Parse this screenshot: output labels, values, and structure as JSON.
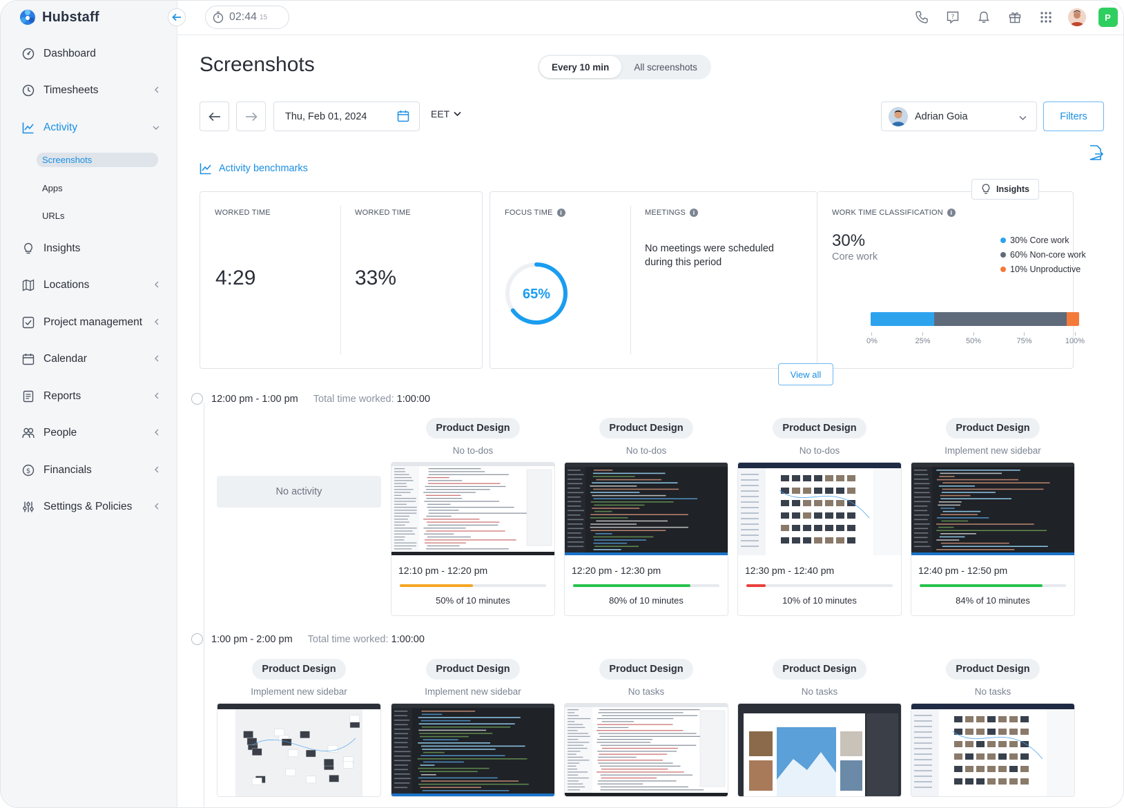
{
  "brand": {
    "name": "Hubstaff"
  },
  "timer": {
    "time": "02:44",
    "seconds": "15"
  },
  "sidebar": {
    "items": [
      {
        "label": "Dashboard",
        "icon": "dashboard-icon"
      },
      {
        "label": "Timesheets",
        "icon": "clock-icon"
      },
      {
        "label": "Activity",
        "icon": "activity-chart-icon",
        "active": true
      },
      {
        "label": "Insights",
        "icon": "lightbulb-icon"
      },
      {
        "label": "Locations",
        "icon": "map-icon"
      },
      {
        "label": "Project management",
        "icon": "checkbox-icon"
      },
      {
        "label": "Calendar",
        "icon": "calendar-icon"
      },
      {
        "label": "Reports",
        "icon": "report-icon"
      },
      {
        "label": "People",
        "icon": "people-icon"
      },
      {
        "label": "Financials",
        "icon": "dollar-icon"
      },
      {
        "label": "Settings & Policies",
        "icon": "sliders-icon"
      }
    ],
    "activity_sub": [
      "Screenshots",
      "Apps",
      "URLs"
    ]
  },
  "page": {
    "title": "Screenshots",
    "view_toggle": {
      "left": "Every 10 min",
      "right": "All screenshots",
      "selected": "Every 10 min"
    },
    "date": "Thu, Feb 01, 2024",
    "timezone": "EET",
    "user": "Adrian Goia",
    "filters_label": "Filters"
  },
  "benchmarks": {
    "title": "Activity benchmarks",
    "worked_time_label": "WORKED TIME",
    "worked_time_value": "4:29",
    "worked_time_label_2": "WORKED TIME",
    "worked_time_value_2": "33%",
    "focus_label": "FOCUS TIME",
    "focus_value": "65%",
    "focus_fraction": 0.65,
    "meetings_label": "MEETINGS",
    "meetings_text": "No meetings were scheduled during this period",
    "view_all": "View all",
    "insights_label": "Insights",
    "classification_label": "WORK TIME CLASSIFICATION",
    "core_value": "30%",
    "core_caption": "Core work",
    "legend": [
      {
        "label": "30% Core work",
        "color": "#2da3ee",
        "pct": 30
      },
      {
        "label": "60% Non-core work",
        "color": "#5f6b7a",
        "pct": 63
      },
      {
        "label": "10% Unproductive",
        "color": "#f47a3a",
        "pct": 6
      }
    ],
    "ticks": [
      "0%",
      "25%",
      "50%",
      "75%",
      "100%"
    ]
  },
  "slots": [
    {
      "range": "12:00  pm - 1:00 pm",
      "total_label": "Total time worked:",
      "total_value": "1:00:00",
      "no_activity": "No activity",
      "shots": [
        {
          "project": "Product Design",
          "task": "No to-dos",
          "time": "12:10 pm - 12:20 pm",
          "activity": "50% of 10 minutes",
          "fraction": 0.5,
          "color": "#f5a623",
          "theme": "light"
        },
        {
          "project": "Product Design",
          "task": "No to-dos",
          "time": "12:20 pm - 12:30 pm",
          "activity": "80% of 10 minutes",
          "fraction": 0.8,
          "color": "#27c24c",
          "theme": "dark"
        },
        {
          "project": "Product Design",
          "task": "No to-dos",
          "time": "12:30 pm - 12:40 pm",
          "activity": "10% of 10 minutes",
          "fraction": 0.13,
          "color": "#e8403a",
          "theme": "grid"
        },
        {
          "project": "Product Design",
          "task": "Implement new sidebar",
          "time": "12:40 pm - 12:50 pm",
          "activity": "84% of 10 minutes",
          "fraction": 0.84,
          "color": "#27c24c",
          "theme": "dark"
        }
      ]
    },
    {
      "range": "1:00  pm - 2:00 pm",
      "total_label": "Total time worked:",
      "total_value": "1:00:00",
      "shots": [
        {
          "project": "Product Design",
          "task": "Implement new sidebar",
          "theme": "canvas"
        },
        {
          "project": "Product Design",
          "task": "Implement new sidebar",
          "theme": "dark"
        },
        {
          "project": "Product Design",
          "task": "No tasks",
          "theme": "light"
        },
        {
          "project": "Product Design",
          "task": "No tasks",
          "theme": "photo"
        },
        {
          "project": "Product Design",
          "task": "No tasks",
          "theme": "grid"
        }
      ]
    }
  ]
}
